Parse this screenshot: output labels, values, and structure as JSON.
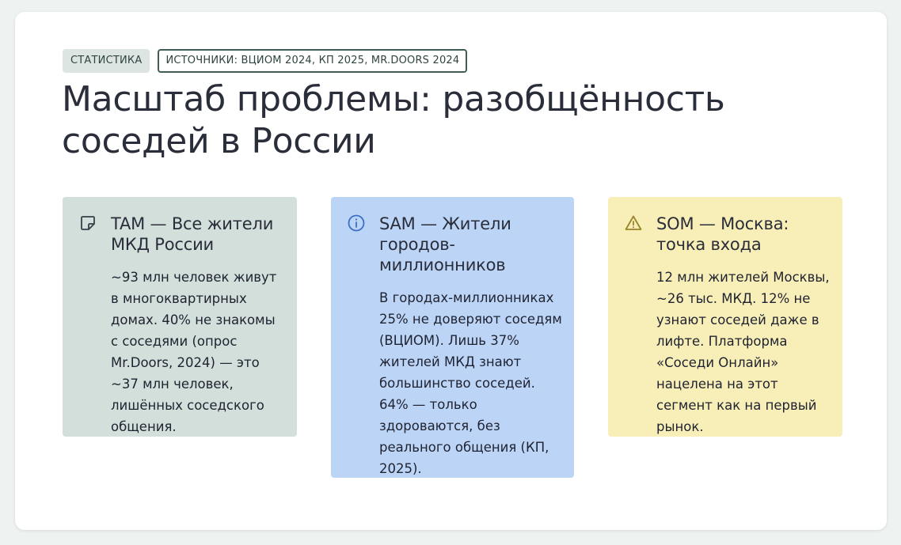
{
  "tags": {
    "category": "СТАТИСТИКА",
    "sources": "ИСТОЧНИКИ: ВЦИОМ 2024, КП 2025, MR.DOORS 2024"
  },
  "title": "Масштаб проблемы: разобщённость соседей в России",
  "cards": [
    {
      "icon": "note-icon",
      "heading": "TAM — Все жители МКД России",
      "body": "~93 млн человек живут в многоквартирных домах. 40% не знакомы с соседями (опрос Mr.Doors, 2024) — это ~37 млн человек, лишённых соседского общения.",
      "color": "#d2dfdb"
    },
    {
      "icon": "info-icon",
      "heading": "SAM — Жители городов-миллионников",
      "body": "В городах-миллионниках 25% не доверяют соседям (ВЦИОМ). Лишь 37% жителей МКД знают большинство соседей. 64% — только здороваются, без реального общения (КП, 2025).",
      "color": "#bcd5f7"
    },
    {
      "icon": "warning-icon",
      "heading": "SOM — Москва: точка входа",
      "body": "12 млн жителей Москвы, ~26 тыс. МКД. 12% не узнают соседей даже в лифте. Платформа «Соседи Онлайн» нацелена на этот сегмент как на первый рынок.",
      "color": "#f8efb8"
    }
  ]
}
